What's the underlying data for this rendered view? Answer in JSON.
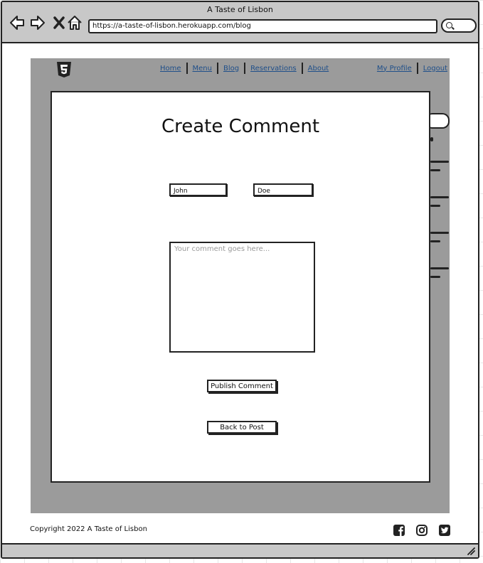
{
  "window": {
    "title": "A Taste of Lisbon"
  },
  "browser": {
    "url": "https://a-taste-of-lisbon.herokuapp.com/blog",
    "icons": [
      "back-arrow-icon",
      "forward-arrow-icon",
      "close-x-icon",
      "home-icon",
      "search-icon"
    ]
  },
  "nav": {
    "logo_icon": "html5-logo-icon",
    "links": [
      "Home",
      "Menu",
      "Blog",
      "Reservations",
      "About"
    ],
    "user_links": [
      "My Profile",
      "Logout"
    ]
  },
  "form": {
    "title": "Create Comment",
    "first_name": "John",
    "last_name": "Doe",
    "comment_placeholder": "Your comment goes here...",
    "publish_label": "Publish Comment",
    "back_label": "Back to Post"
  },
  "footer": {
    "copyright": "Copyright 2022 A Taste of Lisbon",
    "social_icons": [
      "facebook-icon",
      "instagram-icon",
      "twitter-icon"
    ]
  },
  "colors": {
    "content_bg": "#9b9b9b",
    "chrome_bg": "#c8c8c8",
    "link": "#1f4f8a"
  }
}
